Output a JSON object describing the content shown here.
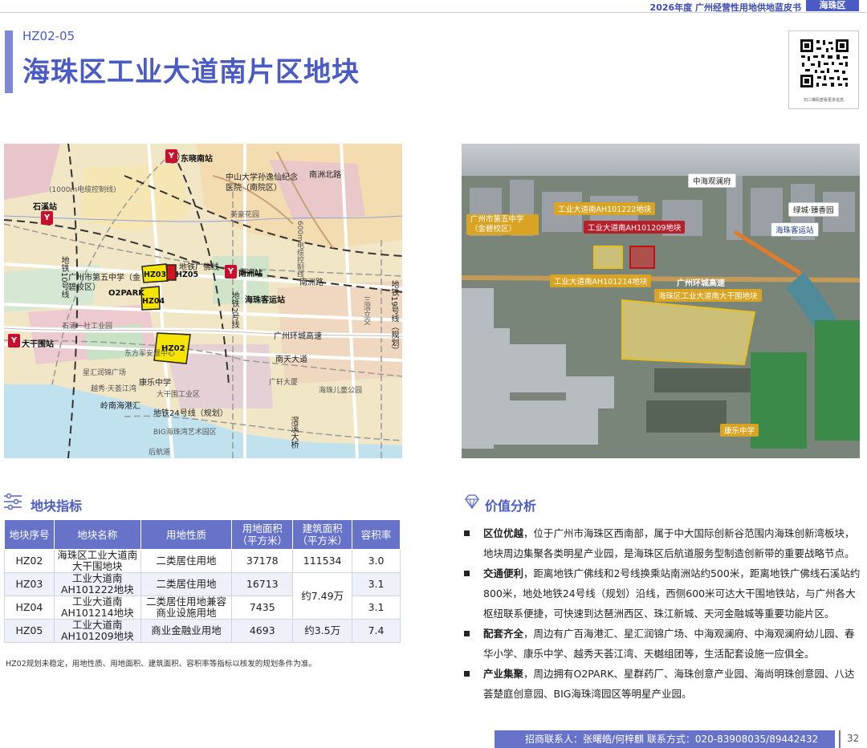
{
  "header": {
    "report_label": "2026年度 广州经营性用地供地蓝皮书",
    "district": "海珠区",
    "code": "HZ02-05",
    "title": "海珠区工业大道南片区地块",
    "qr_caption": "扫二维码查看更多信息"
  },
  "map": {
    "metro_stations": [
      "东晓南站",
      "石溪站",
      "南洲站",
      "大干围站"
    ],
    "labels": [
      "中山大学孙逸仙纪念医院（南院区）",
      "南洲北路",
      "英豪花园",
      "地铁广佛线",
      "广州市第五中学（金碧校区）",
      "O2PARK",
      "南洲路",
      "海珠客运站",
      "石涌一社工业园",
      "广州环城高速",
      "南天大道",
      "康乐中学",
      "星汇润锦广场",
      "越秀·天荟江湾",
      "岭南海港汇",
      "大干围工业区",
      "地铁24号线（规划）",
      "BIG海珠湾艺术园区",
      "后航道",
      "广轩大厦",
      "海珠儿童公园",
      "地铁10号线",
      "地铁2号线",
      "地铁19号线（规划）",
      "三滘立交",
      "滘溪大桥",
      "东方军安置中心",
      "(1000m电缆控制线)",
      "600m电缆控制线"
    ],
    "parcels": [
      "HZ03",
      "HZ05",
      "HZ04",
      "HZ02"
    ]
  },
  "photo": {
    "labels": [
      "中海观澜府",
      "工业大道南AH101222地块",
      "绿城·臻香园",
      "广州市第五中学（金碧校区）",
      "工业大道南AH101209地块",
      "海珠客运站",
      "工业大道南AH101214地块",
      "广州环城高速",
      "海珠区工业大道南大干围地块",
      "康乐中学"
    ]
  },
  "indicators": {
    "heading": "地块指标",
    "columns": [
      "地块序号",
      "地块名称",
      "用地性质",
      "用地面积（平方米）",
      "建筑面积（平方米）",
      "容积率"
    ],
    "rows": [
      {
        "id": "HZ02",
        "name": "海珠区工业大道南大干围地块",
        "use": "二类居住用地",
        "land_area": "37178",
        "floor_area": "111534",
        "far": "3.0"
      },
      {
        "id": "HZ03",
        "name": "工业大道南AH101222地块",
        "use": "二类居住用地",
        "land_area": "16713",
        "floor_area": "约7.49万",
        "far": "3.1"
      },
      {
        "id": "HZ04",
        "name": "工业大道南AH101214地块",
        "use": "二类居住用地兼容商业设施用地",
        "land_area": "7435",
        "floor_area": "",
        "far": "3.1"
      },
      {
        "id": "HZ05",
        "name": "工业大道南AH101209地块",
        "use": "商业金融业用地",
        "land_area": "4693",
        "floor_area": "约3.5万",
        "far": "7.4"
      }
    ],
    "note": "HZ02规划未稳定，用地性质、用地面积、建筑面积、容积率等指标以核发的规划条件为准。"
  },
  "value": {
    "heading": "价值分析",
    "items": [
      {
        "title": "区位优越",
        "text": "，位于广州市海珠区西南部，属于中大国际创新谷范围内海珠创新湾板块，地块周边集聚各类明星产业园，是海珠区后航道服务型制造创新带的重要战略节点。"
      },
      {
        "title": "交通便利",
        "text": "，距离地铁广佛线和2号线换乘站南洲站约500米，距离地铁广佛线石溪站约800米，地处地铁24号线（规划）沿线，西侧600米可达大干围地铁站，与广州各大枢纽联系便捷，可快速到达琶洲西区、珠江新城、天河金融城等重要功能片区。"
      },
      {
        "title": "配套齐全",
        "text": "，周边有广百海港汇、星汇润锦广场、中海观澜府、中海观澜府幼儿园、春华小学、康乐中学、越秀天荟江湾、天樾组团等，生活配套设施一应俱全。"
      },
      {
        "title": "产业集聚",
        "text": "，周边拥有O2PARK、星群药厂、海珠创意产业园、海尚明珠创意园、八达荟楚庭创意园、BIG海珠湾园区等明星产业园。"
      }
    ]
  },
  "footer": {
    "contact": "招商联系人：张曙皓/何梓麒    联系方式：020-83908035/89442432",
    "page": "32"
  },
  "colors": {
    "accent": "#4a5bc4",
    "table_header": "#6673c9",
    "parcel": "#f5e400",
    "metro": "#c8102e"
  }
}
